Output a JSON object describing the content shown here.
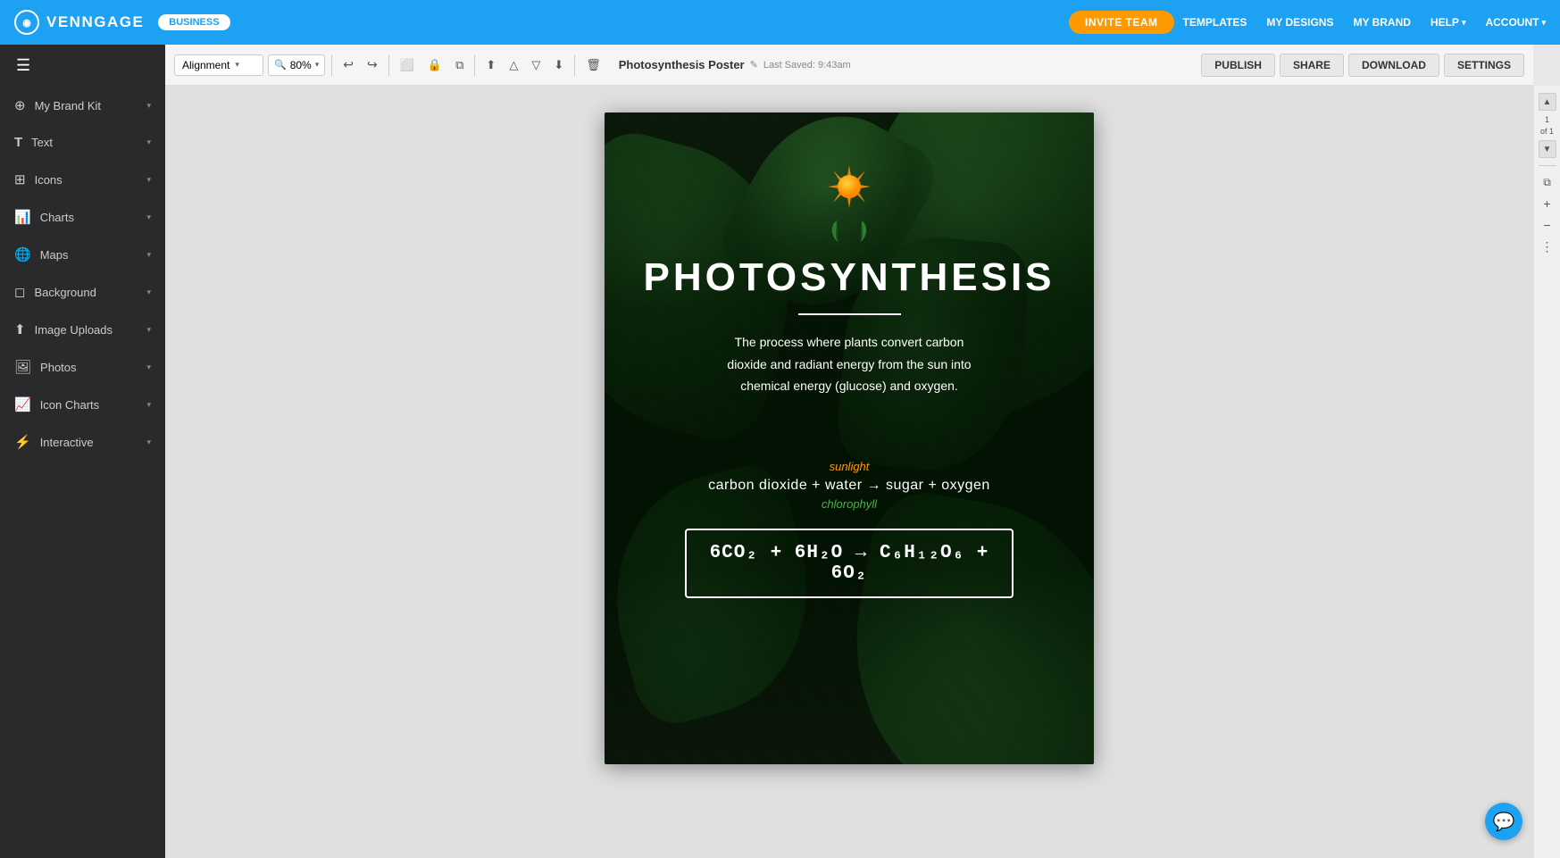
{
  "topnav": {
    "logo_text": "VENNGAGE",
    "business_badge": "BUSINESS",
    "invite_btn": "INVITE TEAM",
    "links": [
      {
        "label": "TEMPLATES",
        "has_dropdown": false
      },
      {
        "label": "MY DESIGNS",
        "has_dropdown": false
      },
      {
        "label": "MY BRAND",
        "has_dropdown": false
      },
      {
        "label": "HELP",
        "has_dropdown": true
      },
      {
        "label": "ACCOUNT",
        "has_dropdown": true
      }
    ]
  },
  "toolbar": {
    "alignment_label": "Alignment",
    "zoom_value": "80%",
    "doc_title": "Photosynthesis Poster",
    "doc_saved": "Last Saved: 9:43am",
    "publish_btn": "PUBLISH",
    "share_btn": "SHARE",
    "download_btn": "DOWNLOAD",
    "settings_btn": "SETTINGS"
  },
  "sidebar": {
    "items": [
      {
        "id": "brand-kit",
        "label": "My Brand Kit",
        "icon": "⊕",
        "has_dropdown": true
      },
      {
        "id": "text",
        "label": "Text",
        "icon": "T",
        "has_dropdown": true
      },
      {
        "id": "icons",
        "label": "Icons",
        "icon": "⊞",
        "has_dropdown": true
      },
      {
        "id": "charts",
        "label": "Charts",
        "icon": "📊",
        "has_dropdown": true
      },
      {
        "id": "maps",
        "label": "Maps",
        "icon": "🌐",
        "has_dropdown": true
      },
      {
        "id": "background",
        "label": "Background",
        "icon": "◻",
        "has_dropdown": true
      },
      {
        "id": "image-uploads",
        "label": "Image Uploads",
        "icon": "⬆",
        "has_dropdown": true
      },
      {
        "id": "photos",
        "label": "Photos",
        "icon": "🖼",
        "has_dropdown": true
      },
      {
        "id": "icon-charts",
        "label": "Icon Charts",
        "icon": "📈",
        "has_dropdown": true
      },
      {
        "id": "interactive",
        "label": "Interactive",
        "icon": "⚡",
        "has_dropdown": true
      }
    ]
  },
  "poster": {
    "title": "PHOTOSYNTHESIS",
    "description": "The process where plants convert carbon\ndioxide and radiant energy from the sun into\nchemical energy (glucose) and oxygen.",
    "sunlight_label": "sunlight",
    "formula_text": "carbon dioxide + water → sugar  +  oxygen",
    "chlorophyll_label": "chlorophyll",
    "chemical_formula": "6CO₂ + 6H₂O → C₆H₁₂O₆ + 6O₂"
  },
  "right_panel": {
    "page_num": "1",
    "page_total": "of 1"
  },
  "chat_icon": "💬"
}
